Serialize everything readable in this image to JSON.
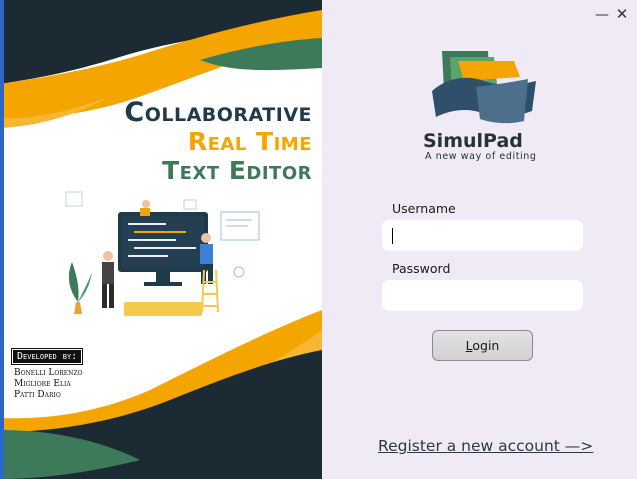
{
  "banner": {
    "title_lines": [
      "Collaborative",
      "Real Time",
      "Text Editor"
    ],
    "developed_by_label": "Developed by:",
    "developers": [
      "Bonelli Lorenzo",
      "Migliore Elia",
      "Patti Dario"
    ],
    "colors": {
      "navy": "#1f3a4a",
      "orange": "#f5a500",
      "green": "#3d7a5a"
    }
  },
  "window_controls": {
    "minimize_icon": "minimize-icon",
    "close_icon": "close-icon",
    "minimize_glyph": "—",
    "close_glyph": "✕"
  },
  "app": {
    "name": "SimulPad",
    "tagline": "A new way of editing",
    "logo_icon": "simulpad-logo-icon"
  },
  "login": {
    "username_label": "Username",
    "username_value": "",
    "password_label": "Password",
    "password_value": "",
    "login_button_first": "L",
    "login_button_rest": "ogin"
  },
  "register_link": "Register a new account —>"
}
